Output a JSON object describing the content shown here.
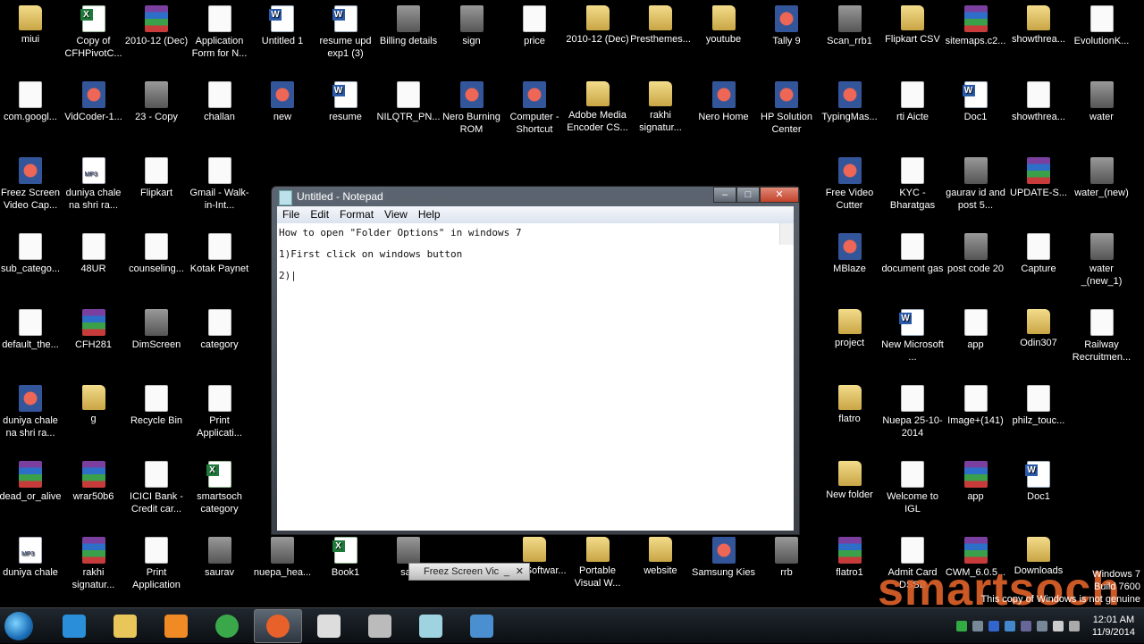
{
  "desktop": {
    "rows": [
      [
        [
          "miui",
          "folder"
        ],
        [
          "Copy of CFHPivotC...",
          "excel"
        ],
        [
          "2010-12 (Dec)",
          "rar"
        ],
        [
          "Application Form for N...",
          "doc"
        ],
        [
          "Untitled 1",
          "word"
        ],
        [
          "resume upd exp1 (3)",
          "word"
        ],
        [
          "Billing details",
          "image"
        ],
        [
          "sign",
          "image"
        ],
        [
          "price",
          "doc"
        ],
        [
          "2010-12 (Dec)",
          "folder"
        ],
        [
          "Presthemes...",
          "folder"
        ],
        [
          "youtube",
          "folder"
        ],
        [
          "Tally 9",
          "app"
        ],
        [
          "Scan_rrb1",
          "image"
        ],
        [
          "Flipkart CSV",
          "folder"
        ],
        [
          "sitemaps.c2...",
          "rar"
        ],
        [
          "showthrea...",
          "folder"
        ],
        [
          "EvolutionK...",
          "doc"
        ]
      ],
      [
        [
          "com.googl...",
          "doc"
        ],
        [
          "VidCoder-1...",
          "app"
        ],
        [
          "23 - Copy",
          "image"
        ],
        [
          "challan",
          "doc"
        ],
        [
          "new",
          "app"
        ],
        [
          "resume",
          "word"
        ],
        [
          "NILQTR_PN...",
          "doc"
        ],
        [
          "Nero Burning ROM",
          "app"
        ],
        [
          "Computer - Shortcut",
          "app"
        ],
        [
          "Adobe Media Encoder CS...",
          "folder"
        ],
        [
          "rakhi signatur...",
          "folder"
        ],
        [
          "Nero Home",
          "app"
        ],
        [
          "HP Solution Center",
          "app"
        ],
        [
          "TypingMas...",
          "app"
        ],
        [
          "rti Aicte",
          "doc"
        ],
        [
          "Doc1",
          "word"
        ],
        [
          "showthrea...",
          "doc"
        ],
        [
          "water",
          "image"
        ]
      ],
      [
        [
          "Freez Screen Video Cap...",
          "app"
        ],
        [
          "duniya chale na shri ra...",
          "mp3"
        ],
        [
          "Flipkart",
          "doc"
        ],
        [
          "Gmail - Walk-in-Int...",
          "doc"
        ],
        null,
        null,
        null,
        null,
        null,
        null,
        null,
        null,
        null,
        [
          "Free Video Cutter",
          "app"
        ],
        [
          "KYC - Bharatgas",
          "doc"
        ],
        [
          "gaurav id and post 5...",
          "image"
        ],
        [
          "UPDATE-S...",
          "rar"
        ],
        [
          "water_(new)",
          "image"
        ]
      ],
      [
        [
          "sub_catego...",
          "doc"
        ],
        [
          "48UR",
          "doc"
        ],
        [
          "counseling...",
          "doc"
        ],
        [
          "Kotak Paynet",
          "doc"
        ],
        null,
        null,
        null,
        null,
        null,
        null,
        null,
        null,
        null,
        [
          "MBlaze",
          "app"
        ],
        [
          "document gas",
          "doc"
        ],
        [
          "post code 20",
          "image"
        ],
        [
          "Capture",
          "doc"
        ],
        [
          "water _(new_1)",
          "image"
        ]
      ],
      [
        [
          "default_the...",
          "doc"
        ],
        [
          "CFH281",
          "rar"
        ],
        [
          "DimScreen",
          "image"
        ],
        [
          "category",
          "doc"
        ],
        null,
        null,
        null,
        null,
        null,
        null,
        null,
        null,
        null,
        [
          "project",
          "folder"
        ],
        [
          "New Microsoft ...",
          "word"
        ],
        [
          "app",
          "doc"
        ],
        [
          "Odin307",
          "folder"
        ],
        [
          "Railway Recruitmen...",
          "doc"
        ]
      ],
      [
        [
          "duniya chale na shri ra...",
          "app"
        ],
        [
          "g",
          "folder"
        ],
        [
          "Recycle Bin",
          "doc"
        ],
        [
          "Print Applicati...",
          "doc"
        ],
        null,
        null,
        null,
        null,
        null,
        null,
        null,
        null,
        null,
        [
          "flatro",
          "folder"
        ],
        [
          "Nuepa 25-10-2014",
          "doc"
        ],
        [
          "Image+(141)",
          "doc"
        ],
        [
          "philz_touc...",
          "doc"
        ],
        null
      ],
      [
        [
          "dead_or_alive",
          "rar"
        ],
        [
          "wrar50b6",
          "rar"
        ],
        [
          "ICICI Bank - Credit car...",
          "doc"
        ],
        [
          "smartsoch category",
          "excel"
        ],
        null,
        null,
        null,
        null,
        null,
        null,
        null,
        null,
        null,
        [
          "New folder",
          "folder"
        ],
        [
          "Welcome to IGL",
          "doc"
        ],
        [
          "app",
          "rar"
        ],
        [
          "Doc1",
          "word"
        ],
        null
      ],
      [
        [
          "duniya chale",
          "mp3"
        ],
        [
          "rakhi signatur...",
          "rar"
        ],
        [
          "Print Application",
          "doc"
        ],
        [
          "saurav",
          "image"
        ],
        [
          "nuepa_hea...",
          "image"
        ],
        [
          "Book1",
          "excel"
        ],
        [
          "sau",
          "image"
        ],
        null,
        [
          "Your Softwar...",
          "folder"
        ],
        [
          "Portable Visual W...",
          "folder"
        ],
        [
          "website",
          "folder"
        ],
        [
          "Samsung Kies",
          "app"
        ],
        [
          "rrb",
          "image"
        ],
        [
          "flatro1",
          "rar"
        ],
        [
          "Admit Card DSSB",
          "doc"
        ],
        [
          "CWM_6.0.5...",
          "rar"
        ],
        [
          "Downloads",
          "folder"
        ],
        null
      ]
    ]
  },
  "notepad": {
    "title": "Untitled - Notepad",
    "minimize": "–",
    "maximize": "□",
    "close": "✕",
    "menu": [
      "File",
      "Edit",
      "Format",
      "View",
      "Help"
    ],
    "lines": [
      "How to open \"Folder Options\" in windows 7",
      "1)First click on windows button",
      "2)|"
    ]
  },
  "freez_popup": {
    "label": "Freez Screen Vic",
    "minimize": "_",
    "close": "✕"
  },
  "watermark": {
    "line1": "Windows 7",
    "line2": "Build 7600",
    "line3": "This copy of Windows is not genuine"
  },
  "logo": "smartsoch",
  "taskbar": {
    "apps": [
      [
        "internet-explorer",
        "#2a8fd8"
      ],
      [
        "windows-explorer",
        "#e8c65a"
      ],
      [
        "media-player",
        "#f08a24"
      ],
      [
        "chrome",
        "#3aa84a"
      ],
      [
        "firefox",
        "#e8602a"
      ],
      [
        "blank-app",
        "#ddd"
      ],
      [
        "camera-app",
        "#bbb"
      ],
      [
        "notepad",
        "#9fd3e0"
      ],
      [
        "control-panel",
        "#4a8fd0"
      ]
    ],
    "active_index": 4
  },
  "clock": {
    "time": "12:01 AM",
    "date": "11/9/2014"
  }
}
